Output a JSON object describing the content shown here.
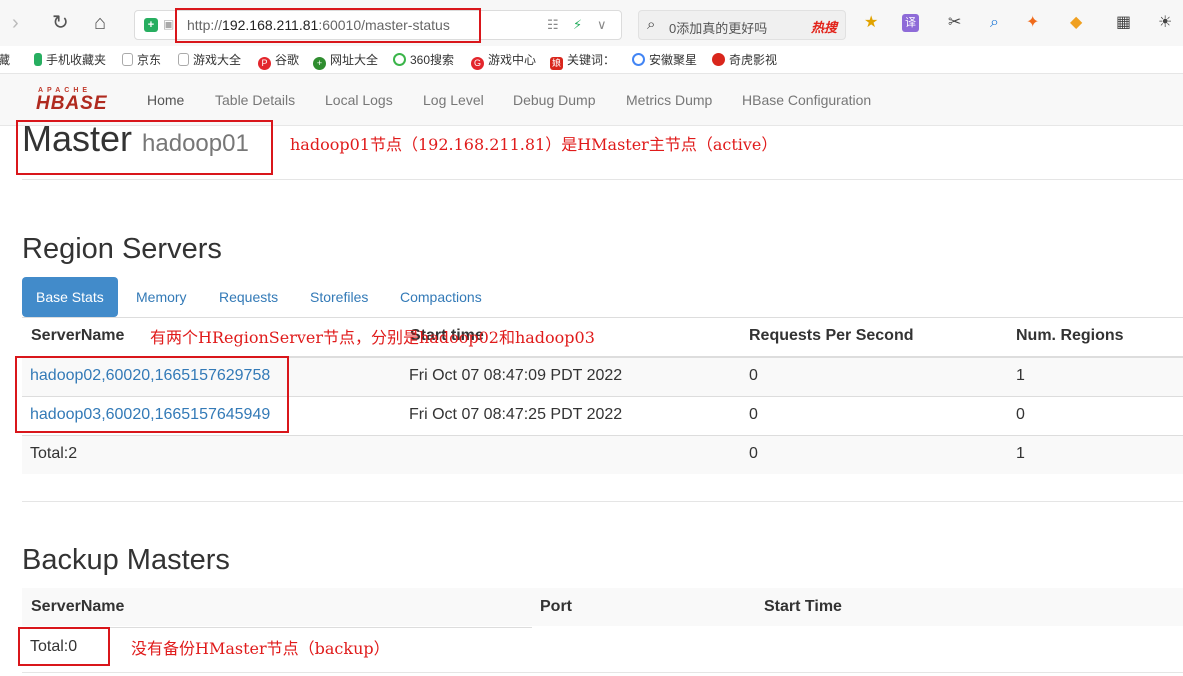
{
  "browser": {
    "url_prefix": "http://",
    "url_host": "192.168.211.81",
    "url_path": ":60010/master-status",
    "search_placeholder": "0添加真的更好吗",
    "search_hot": "热搜"
  },
  "bookmarks": [
    "藏",
    "手机收藏夹",
    "京东",
    "游戏大全",
    "谷歌",
    "网址大全",
    "360搜索",
    "游戏中心",
    "关键词：",
    "安徽聚星",
    "奇虎影视"
  ],
  "nav": {
    "logo_top": "APACHE",
    "logo_main": "HBASE",
    "links": [
      "Home",
      "Table Details",
      "Local Logs",
      "Log Level",
      "Debug Dump",
      "Metrics Dump",
      "HBase Configuration"
    ]
  },
  "master": {
    "title": "Master",
    "host": "hadoop01"
  },
  "region_servers": {
    "heading": "Region Servers",
    "tabs": [
      "Base Stats",
      "Memory",
      "Requests",
      "Storefiles",
      "Compactions"
    ],
    "columns": [
      "ServerName",
      "Start time",
      "Requests Per Second",
      "Num. Regions"
    ],
    "rows": [
      {
        "server": "hadoop02,60020,1665157629758",
        "start": "Fri Oct 07 08:47:09 PDT 2022",
        "rps": "0",
        "regions": "1"
      },
      {
        "server": "hadoop03,60020,1665157645949",
        "start": "Fri Oct 07 08:47:25 PDT 2022",
        "rps": "0",
        "regions": "0"
      }
    ],
    "total": {
      "label": "Total:2",
      "rps": "0",
      "regions": "1"
    }
  },
  "backup_masters": {
    "heading": "Backup Masters",
    "columns": [
      "ServerName",
      "Port",
      "Start Time"
    ],
    "total": "Total:0"
  },
  "annotations": {
    "master_note": "hadoop01节点（192.168.211.81）是HMaster主节点（active）",
    "region_note": "有两个HRegionServer节点，分别是hadoop02和hadoop03",
    "backup_note": "没有备份HMaster节点（backup）"
  },
  "colors": {
    "annotation": "#e01b1b",
    "link": "#337ab7",
    "active_tab": "#428bca"
  }
}
